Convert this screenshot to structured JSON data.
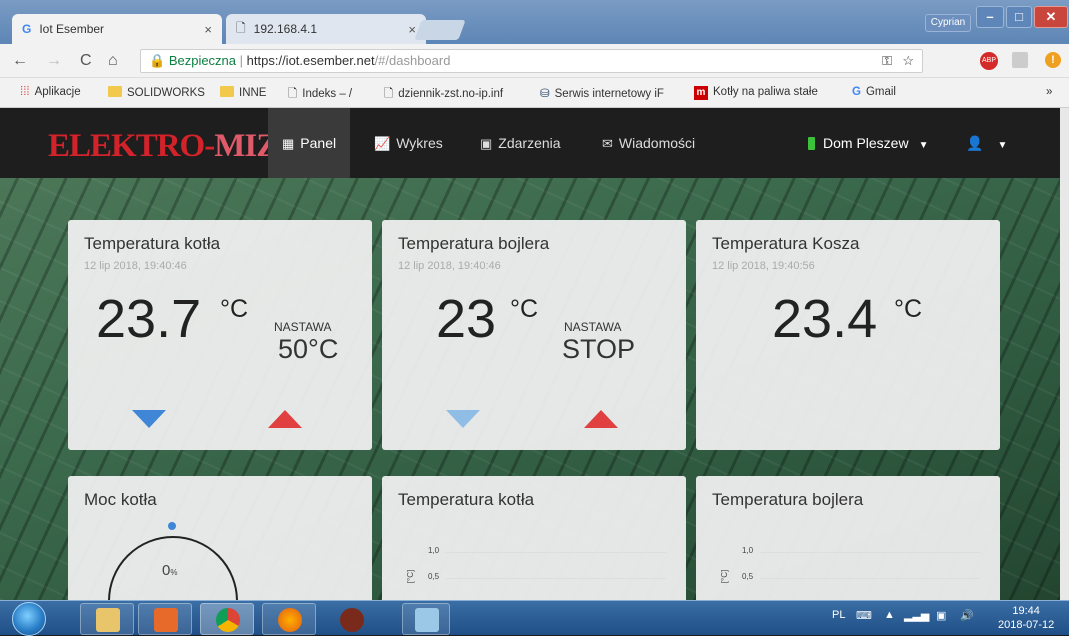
{
  "browser": {
    "tabs": [
      {
        "title": "Iot Esember",
        "close": "×",
        "icon": "google-g-icon"
      },
      {
        "title": "192.168.4.1",
        "close": "×",
        "icon": "page-icon"
      }
    ],
    "window_user": "Cyprian",
    "address": {
      "secure_label": "Bezpieczna",
      "url_main": "https://iot.esember.net",
      "url_rest": "/#/dashboard"
    },
    "bookmarks": [
      {
        "label": "Aplikacje",
        "icon": "apps-grid-icon"
      },
      {
        "label": "SOLIDWORKS",
        "icon": "folder-icon"
      },
      {
        "label": "INNE",
        "icon": "folder-icon"
      },
      {
        "label": "Indeks – /",
        "icon": "page-icon"
      },
      {
        "label": "dziennik-zst.no-ip.inf",
        "icon": "page-icon"
      },
      {
        "label": "Serwis internetowy iF",
        "icon": "bank-icon"
      },
      {
        "label": "Kotły na paliwa stałe",
        "icon": "m-logo-icon"
      },
      {
        "label": "Gmail",
        "icon": "google-g-icon"
      }
    ],
    "bookmarks_overflow": "»"
  },
  "app": {
    "logo_part1": "ELEKTRO-",
    "logo_part2": "MIZ",
    "nav": [
      {
        "label": "Panel",
        "icon": "dashboard-icon",
        "active": true
      },
      {
        "label": "Wykres",
        "icon": "chart-icon",
        "active": false
      },
      {
        "label": "Zdarzenia",
        "icon": "calendar-icon",
        "active": false
      },
      {
        "label": "Wiadomości",
        "icon": "envelope-icon",
        "active": false
      }
    ],
    "location": "Dom Pleszew",
    "status_color": "#3cc13c",
    "user_icon": "user-icon"
  },
  "cards": [
    {
      "title": "Temperatura kotła",
      "time": "12 lip 2018, 19:40:46",
      "value": "23.7",
      "unit": "°C",
      "nastawa_label": "NASTAWA",
      "nastawa_value": "50°C"
    },
    {
      "title": "Temperatura bojlera",
      "time": "12 lip 2018, 19:40:46",
      "value": "23",
      "unit": "°C",
      "nastawa_label": "NASTAWA",
      "nastawa_value": "STOP"
    },
    {
      "title": "Temperatura Kosza",
      "time": "12 lip 2018, 19:40:56",
      "value": "23.4",
      "unit": "°C"
    }
  ],
  "bottom_cards": [
    {
      "title": "Moc kotła",
      "gauge_value": "0",
      "gauge_unit": "%",
      "gauge_level": 0
    },
    {
      "title": "Temperatura kotła",
      "ticks": [
        "1,0",
        "0,5"
      ],
      "axis_label": "[°C]"
    },
    {
      "title": "Temperatura bojlera",
      "ticks": [
        "1,0",
        "0,5"
      ],
      "axis_label": "[°C]"
    }
  ],
  "taskbar": {
    "lang": "PL",
    "time": "19:44",
    "date": "2018-07-12"
  },
  "colors": {
    "down_arrow": "#3f87d6",
    "up_arrow": "#e04040",
    "logo_red": "#d2232a"
  }
}
